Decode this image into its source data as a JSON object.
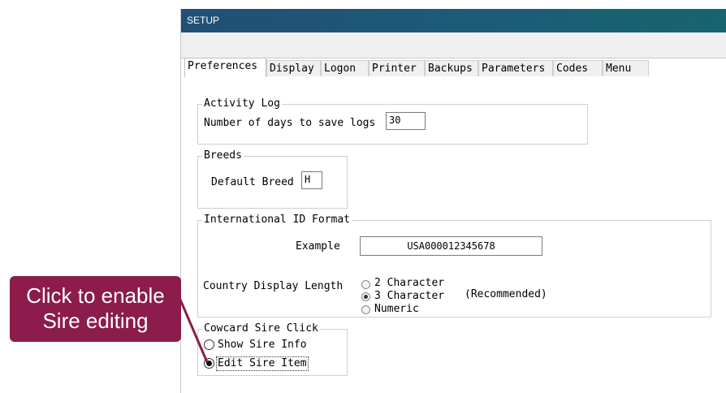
{
  "window": {
    "title": "SETUP"
  },
  "tabs": [
    "Preferences",
    "Display",
    "Logon",
    "Printer",
    "Backups",
    "Parameters",
    "Codes",
    "Menu"
  ],
  "activity_log": {
    "legend": "Activity Log",
    "days_label": "Number of days to save logs",
    "days_value": "30"
  },
  "breeds": {
    "legend": "Breeds",
    "default_label": "Default Breed",
    "default_value": "H"
  },
  "intl_id": {
    "legend": "International ID Format",
    "example_label": "Example",
    "example_value": "USA000012345678",
    "country_label": "Country Display Length",
    "options": [
      "2 Character",
      "3 Character",
      "Numeric"
    ],
    "selected": "3 Character",
    "recommended": "(Recommended)"
  },
  "cowcard": {
    "legend": "Cowcard Sire Click",
    "options": [
      "Show Sire Info",
      "Edit Sire Item"
    ],
    "selected": "Edit Sire Item"
  },
  "callout": {
    "line1": "Click to enable",
    "line2": "Sire editing",
    "color": "#8b1c4c"
  },
  "colors": {
    "titlebar": "#1c5b78"
  }
}
